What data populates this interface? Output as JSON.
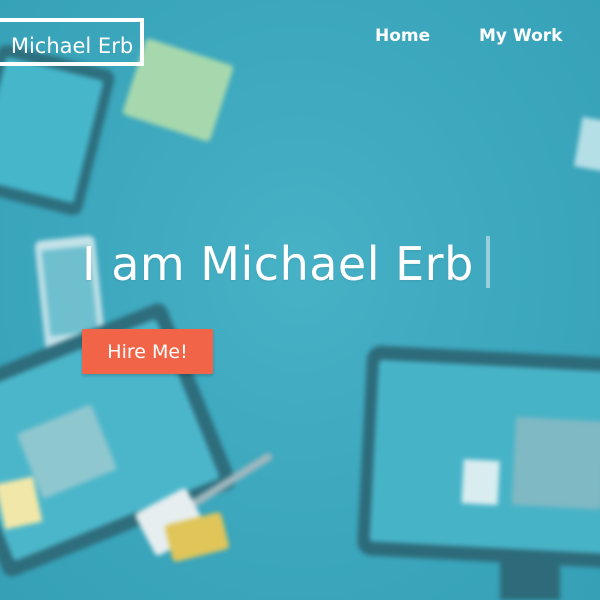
{
  "header": {
    "logo_text": "Michael Erb",
    "nav": [
      {
        "label": "Home"
      },
      {
        "label": "My Work"
      }
    ]
  },
  "hero": {
    "title": "I am Michael Erb",
    "cta_label": "Hire Me!"
  },
  "colors": {
    "background": "#3ca7bd",
    "cta": "#f26447",
    "text": "#ffffff"
  }
}
